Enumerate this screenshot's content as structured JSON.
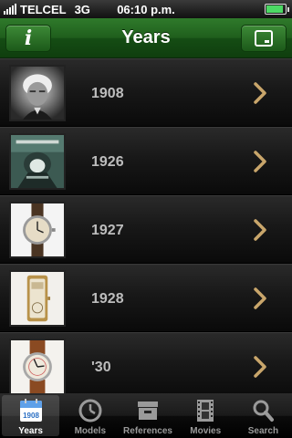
{
  "status_bar": {
    "carrier": "TELCEL",
    "network": "3G",
    "time": "06:10 p.m.",
    "battery_level": 0.9
  },
  "nav_bar": {
    "title": "Years",
    "left_button_icon": "info-icon",
    "right_button_icon": "screen-icon",
    "info_glyph": "i"
  },
  "list": {
    "items": [
      {
        "label": "1908",
        "thumbnail": "portrait-photo"
      },
      {
        "label": "1926",
        "thumbnail": "vintage-photo"
      },
      {
        "label": "1927",
        "thumbnail": "round-watch"
      },
      {
        "label": "1928",
        "thumbnail": "rectangular-watch"
      },
      {
        "label": "'30",
        "thumbnail": "leather-strap-watch"
      }
    ]
  },
  "tab_bar": {
    "tabs": [
      {
        "label": "Years",
        "icon": "calendar-icon",
        "icon_text": "1908",
        "active": true
      },
      {
        "label": "Models",
        "icon": "clock-icon",
        "active": false
      },
      {
        "label": "References",
        "icon": "archive-icon",
        "active": false
      },
      {
        "label": "Movies",
        "icon": "film-icon",
        "active": false
      },
      {
        "label": "Search",
        "icon": "search-icon",
        "active": false
      }
    ]
  },
  "colors": {
    "nav_green": "#1f5e1c",
    "year_text": "#bdbdbd",
    "chevron": "#c9a66b",
    "active_tab_icon": "#5fa0e8"
  }
}
